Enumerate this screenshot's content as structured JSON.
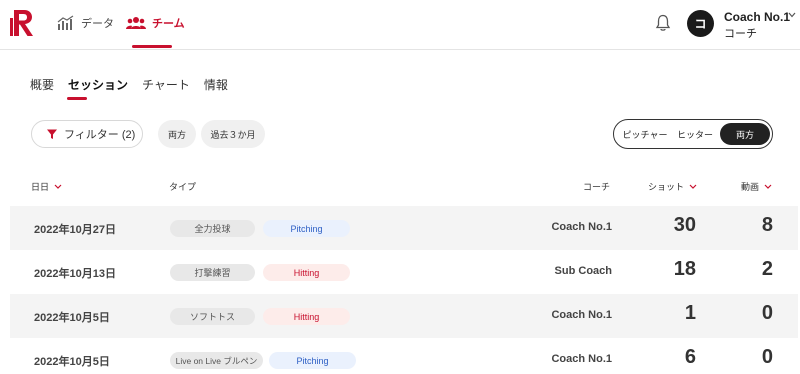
{
  "nav": {
    "items": [
      {
        "label": "データ",
        "icon": "chart-icon",
        "active": false
      },
      {
        "label": "チーム",
        "icon": "team-icon",
        "active": true
      }
    ],
    "accent": "#c8102e"
  },
  "user": {
    "initial": "コ",
    "name": "Coach No.1",
    "role": "コーチ"
  },
  "tabs": [
    {
      "label": "概要",
      "active": false
    },
    {
      "label": "セッション",
      "active": true
    },
    {
      "label": "チャート",
      "active": false
    },
    {
      "label": "情報",
      "active": false
    }
  ],
  "filters": {
    "filter_label": "フィルター (2)",
    "chips": [
      "両方",
      "過去３か月"
    ]
  },
  "segmented": {
    "options": [
      "ピッチャー",
      "ヒッター",
      "両方"
    ],
    "selected": "両方"
  },
  "table": {
    "headers": {
      "date": "日日",
      "type": "タイプ",
      "coach": "コーチ",
      "shots": "ショット",
      "videos": "動画"
    },
    "rows": [
      {
        "date": "2022年10月27日",
        "type": "全力投球",
        "kind": "Pitching",
        "coach": "Coach No.1",
        "shots": "30",
        "videos": "8"
      },
      {
        "date": "2022年10月13日",
        "type": "打撃練習",
        "kind": "Hitting",
        "coach": "Sub Coach",
        "shots": "18",
        "videos": "2"
      },
      {
        "date": "2022年10月5日",
        "type": "ソフトトス",
        "kind": "Hitting",
        "coach": "Coach No.1",
        "shots": "1",
        "videos": "0"
      },
      {
        "date": "2022年10月5日",
        "type": "Live on Live ブルペン",
        "kind": "Pitching",
        "coach": "Coach No.1",
        "shots": "6",
        "videos": "0"
      }
    ]
  }
}
